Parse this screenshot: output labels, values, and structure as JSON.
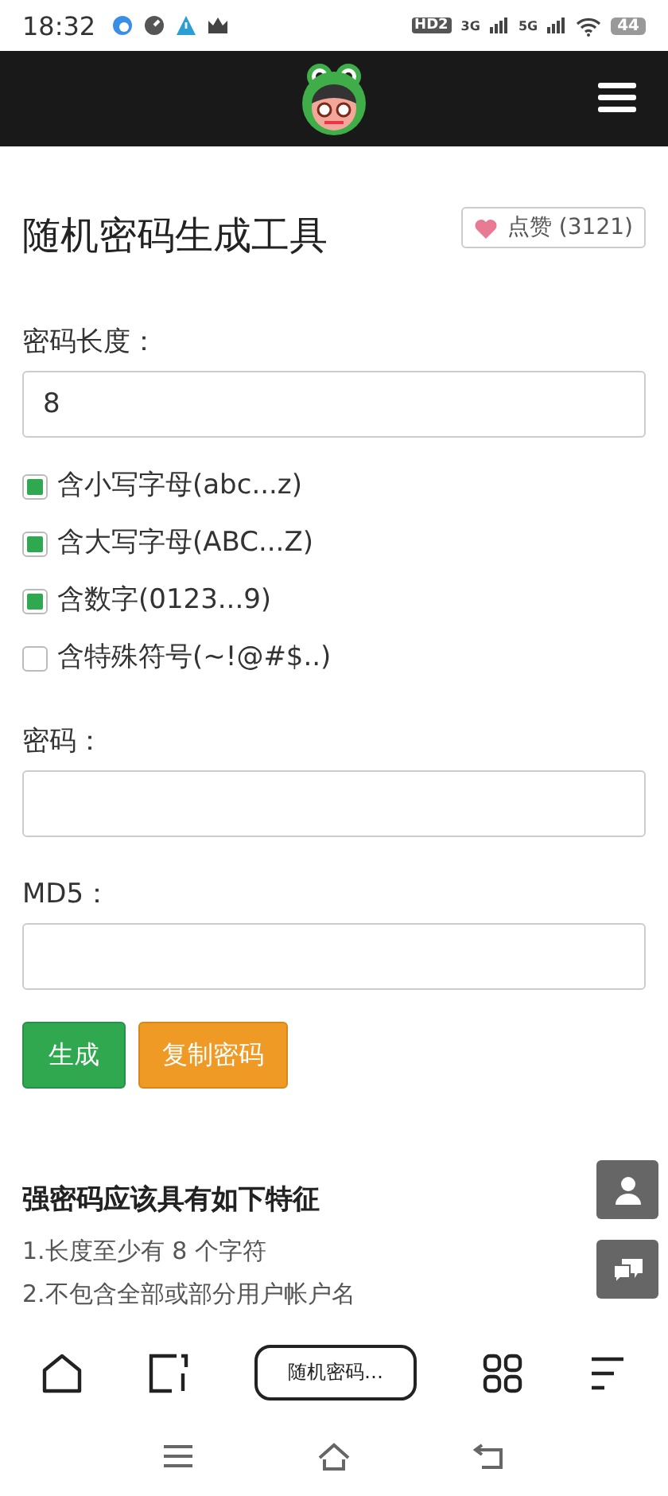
{
  "status_bar": {
    "time": "18:32",
    "hd": "HD2",
    "net_1": "3G",
    "net_2": "5G",
    "battery": "44"
  },
  "page": {
    "title": "随机密码生成工具",
    "like_button": "点赞 (3121)",
    "length_label": "密码长度：",
    "length_value": "8",
    "options": [
      {
        "label": "含小写字母(abc...z)",
        "checked": true
      },
      {
        "label": "含大写字母(ABC...Z)",
        "checked": true
      },
      {
        "label": "含数字(0123...9)",
        "checked": true
      },
      {
        "label": "含特殊符号(~!@#$..)",
        "checked": false
      }
    ],
    "password_label": "密码：",
    "md5_label": "MD5：",
    "buttons": [
      {
        "label": "生成",
        "kind": "primary"
      },
      {
        "label": "复制密码",
        "kind": "warning"
      }
    ],
    "tips_heading": "强密码应该具有如下特征",
    "tips": [
      "1.长度至少有 8 个字符",
      "2.不包含全部或部分用户帐户名"
    ]
  },
  "browser_bar": {
    "tab_title": "随机密码…"
  }
}
